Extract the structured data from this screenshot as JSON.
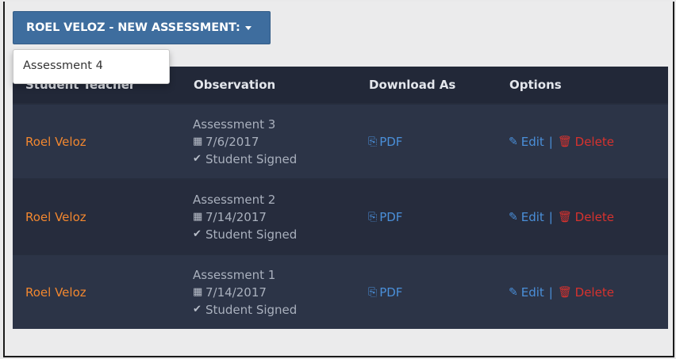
{
  "dropdown": {
    "label": "ROEL VELOZ - NEW ASSESSMENT:",
    "items": [
      "Assessment 4"
    ]
  },
  "table": {
    "headers": [
      "Student Teacher",
      "Observation",
      "Download As",
      "Options"
    ],
    "rows": [
      {
        "student": "Roel Veloz",
        "assessment": "Assessment 3",
        "date": "7/6/2017",
        "status": "Student Signed",
        "download": "PDF",
        "edit": "Edit",
        "separator": "|",
        "delete": "Delete"
      },
      {
        "student": "Roel Veloz",
        "assessment": "Assessment 2",
        "date": "7/14/2017",
        "status": "Student Signed",
        "download": "PDF",
        "edit": "Edit",
        "separator": "|",
        "delete": "Delete"
      },
      {
        "student": "Roel Veloz",
        "assessment": "Assessment 1",
        "date": "7/14/2017",
        "status": "Student Signed",
        "download": "PDF",
        "edit": "Edit",
        "separator": "|",
        "delete": "Delete"
      }
    ]
  },
  "icons": {
    "calendar": "calendar-icon",
    "check": "check-icon",
    "pdf": "pdf-file-icon",
    "edit": "edit-icon",
    "delete": "trash-icon",
    "caret": "caret-down-icon"
  },
  "colors": {
    "button_bg": "#3e6d9e",
    "table_header_bg": "#222838",
    "student_name": "#f2872f",
    "link": "#4a8fd9",
    "delete": "#d7322e"
  }
}
